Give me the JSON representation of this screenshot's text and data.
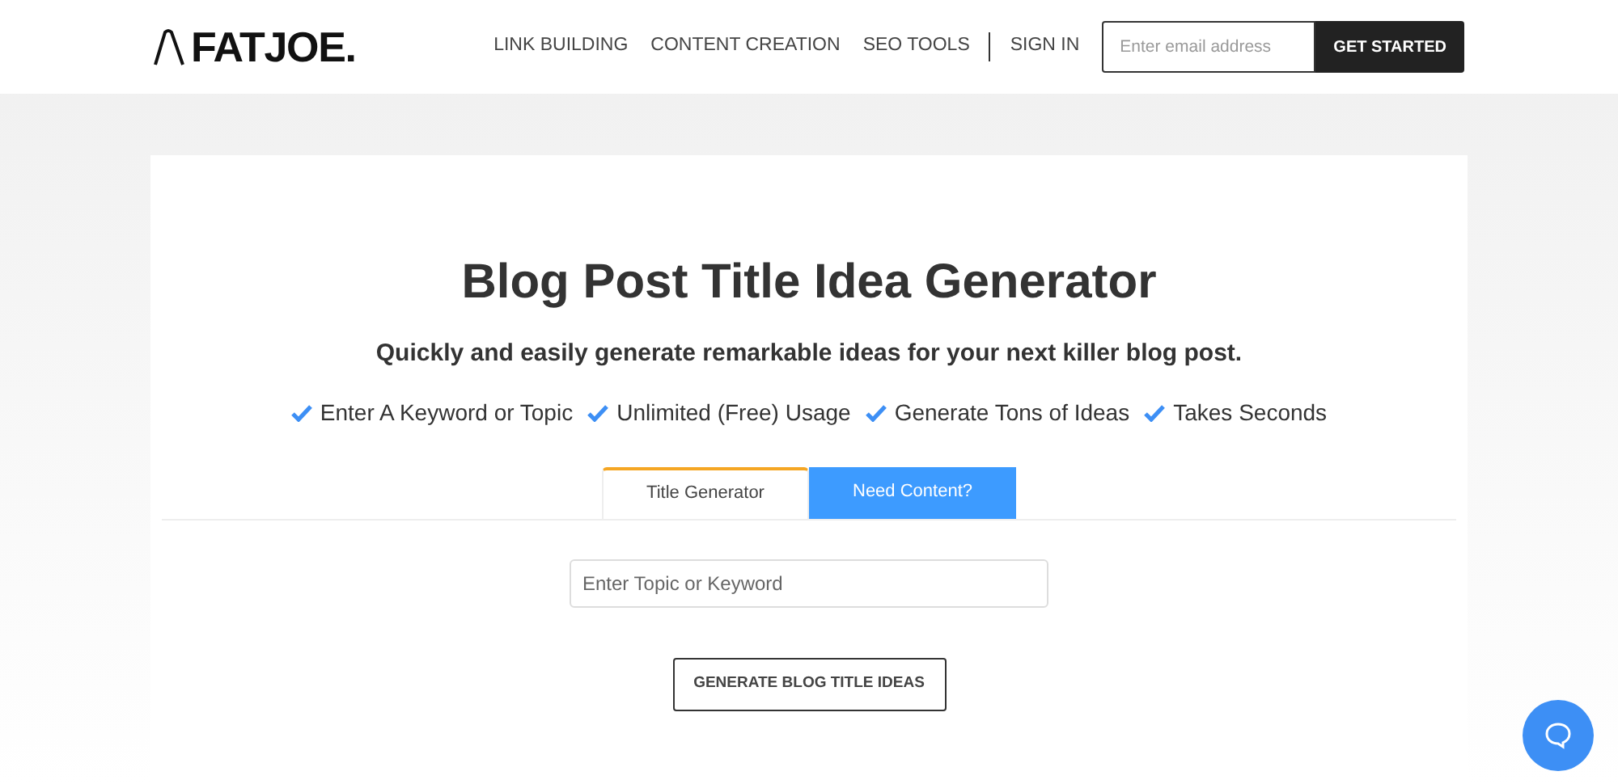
{
  "header": {
    "logo": "FATJOE.",
    "nav": [
      {
        "label": "LINK BUILDING"
      },
      {
        "label": "CONTENT CREATION"
      },
      {
        "label": "SEO TOOLS"
      },
      {
        "label": "SIGN IN"
      }
    ],
    "email": {
      "placeholder": "Enter email address"
    },
    "cta": "GET STARTED"
  },
  "hero": {
    "title": "Blog Post Title Idea Generator",
    "subtitle": "Quickly and easily generate remarkable ideas for your next killer blog post.",
    "features": [
      "Enter A Keyword or Topic",
      "Unlimited (Free) Usage",
      "Generate Tons of Ideas",
      "Takes Seconds"
    ]
  },
  "tabs": [
    {
      "label": "Title Generator",
      "selected": true
    },
    {
      "label": "Need Content?",
      "selected": false
    }
  ],
  "topic": {
    "placeholder": "Enter Topic or Keyword"
  },
  "generate_button": "GENERATE BLOG TITLE IDEAS"
}
